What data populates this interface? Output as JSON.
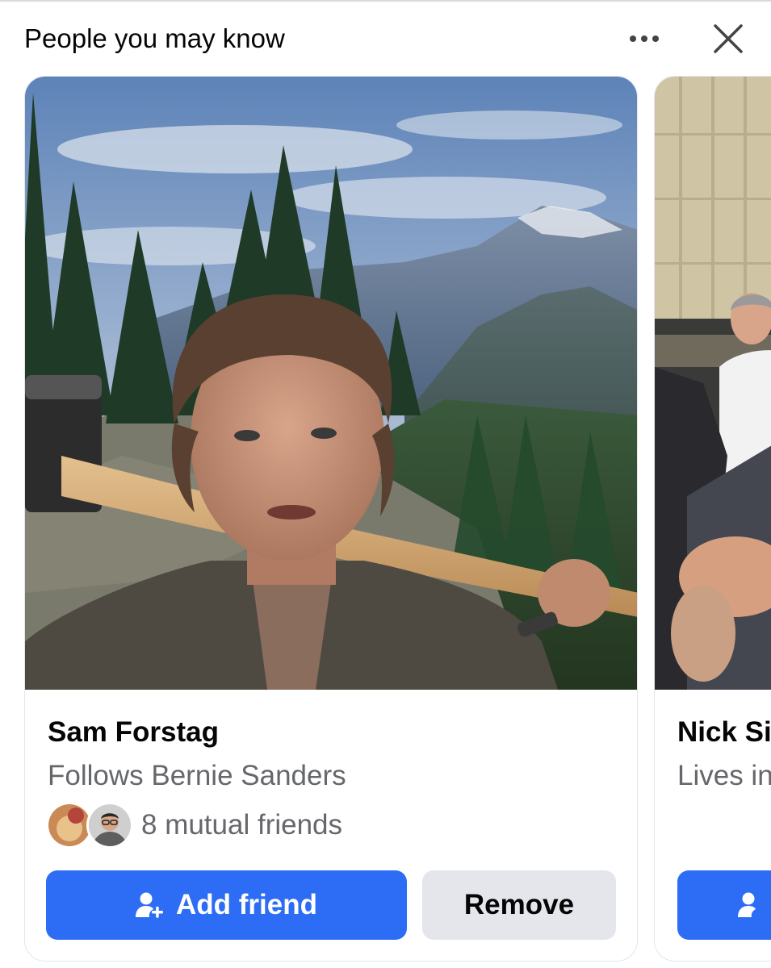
{
  "section": {
    "title": "People you may know",
    "more_icon": "more-dots-icon",
    "close_icon": "close-icon"
  },
  "cards": [
    {
      "name": "Sam Forstag",
      "subtitle": "Follows Bernie Sanders",
      "mutual": "8 mutual friends",
      "add_label": "Add friend",
      "remove_label": "Remove",
      "add_icon": "add-person-icon"
    },
    {
      "name": "Nick Si",
      "subtitle": "Lives in",
      "add_icon": "add-person-icon"
    }
  ],
  "colors": {
    "primary": "#2d6df6",
    "secondary_bg": "#e4e6eb",
    "text": "#050505",
    "muted": "#65676b"
  }
}
